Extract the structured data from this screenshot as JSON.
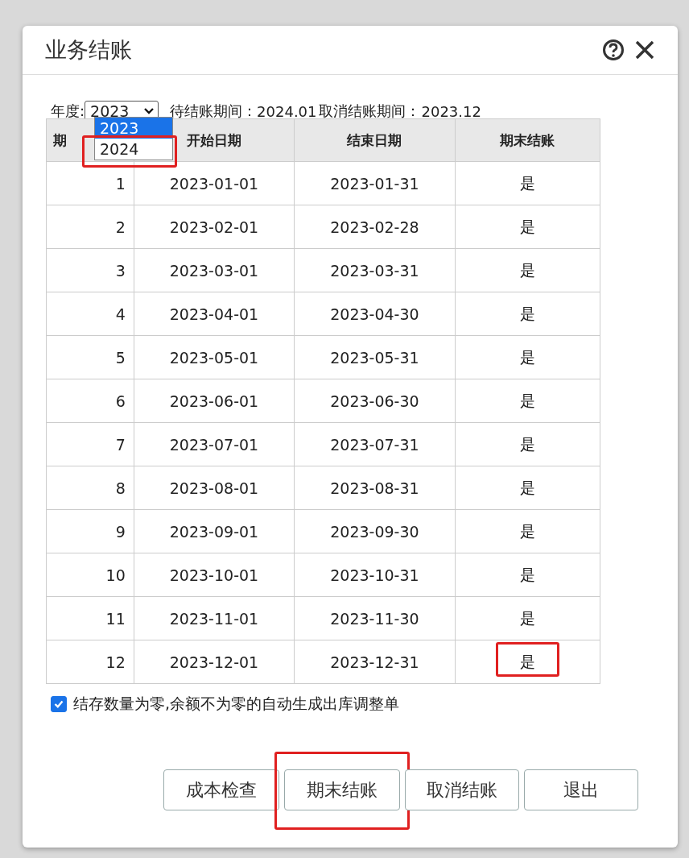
{
  "dialog": {
    "title": "业务结账"
  },
  "filter": {
    "label": "年度:",
    "value": "2023",
    "options": [
      {
        "label": "2023",
        "selected": true,
        "highlighted": false
      },
      {
        "label": "2024",
        "selected": false,
        "highlighted": true
      }
    ],
    "pending_label": "待结账期间：",
    "pending_value": "2024.01",
    "cancel_label": "取消结账期间：",
    "cancel_value": "2023.12"
  },
  "table": {
    "columns": [
      "期",
      "开始日期",
      "结束日期",
      "期末结账"
    ],
    "rows": [
      {
        "period": "1",
        "start": "2023-01-01",
        "end": "2023-01-31",
        "closed": "是",
        "highlighted": false
      },
      {
        "period": "2",
        "start": "2023-02-01",
        "end": "2023-02-28",
        "closed": "是",
        "highlighted": false
      },
      {
        "period": "3",
        "start": "2023-03-01",
        "end": "2023-03-31",
        "closed": "是",
        "highlighted": false
      },
      {
        "period": "4",
        "start": "2023-04-01",
        "end": "2023-04-30",
        "closed": "是",
        "highlighted": false
      },
      {
        "period": "5",
        "start": "2023-05-01",
        "end": "2023-05-31",
        "closed": "是",
        "highlighted": false
      },
      {
        "period": "6",
        "start": "2023-06-01",
        "end": "2023-06-30",
        "closed": "是",
        "highlighted": false
      },
      {
        "period": "7",
        "start": "2023-07-01",
        "end": "2023-07-31",
        "closed": "是",
        "highlighted": false
      },
      {
        "period": "8",
        "start": "2023-08-01",
        "end": "2023-08-31",
        "closed": "是",
        "highlighted": false
      },
      {
        "period": "9",
        "start": "2023-09-01",
        "end": "2023-09-30",
        "closed": "是",
        "highlighted": false
      },
      {
        "period": "10",
        "start": "2023-10-01",
        "end": "2023-10-31",
        "closed": "是",
        "highlighted": false
      },
      {
        "period": "11",
        "start": "2023-11-01",
        "end": "2023-11-30",
        "closed": "是",
        "highlighted": false
      },
      {
        "period": "12",
        "start": "2023-12-01",
        "end": "2023-12-31",
        "closed": "是",
        "highlighted": true
      }
    ]
  },
  "option": {
    "label": "结存数量为零,余额不为零的自动生成出库调整单",
    "checked": true
  },
  "buttons": [
    {
      "label": "成本检查",
      "highlighted": false
    },
    {
      "label": "期末结账",
      "highlighted": true
    },
    {
      "label": "取消结账",
      "highlighted": false
    },
    {
      "label": "退出",
      "highlighted": false
    }
  ]
}
